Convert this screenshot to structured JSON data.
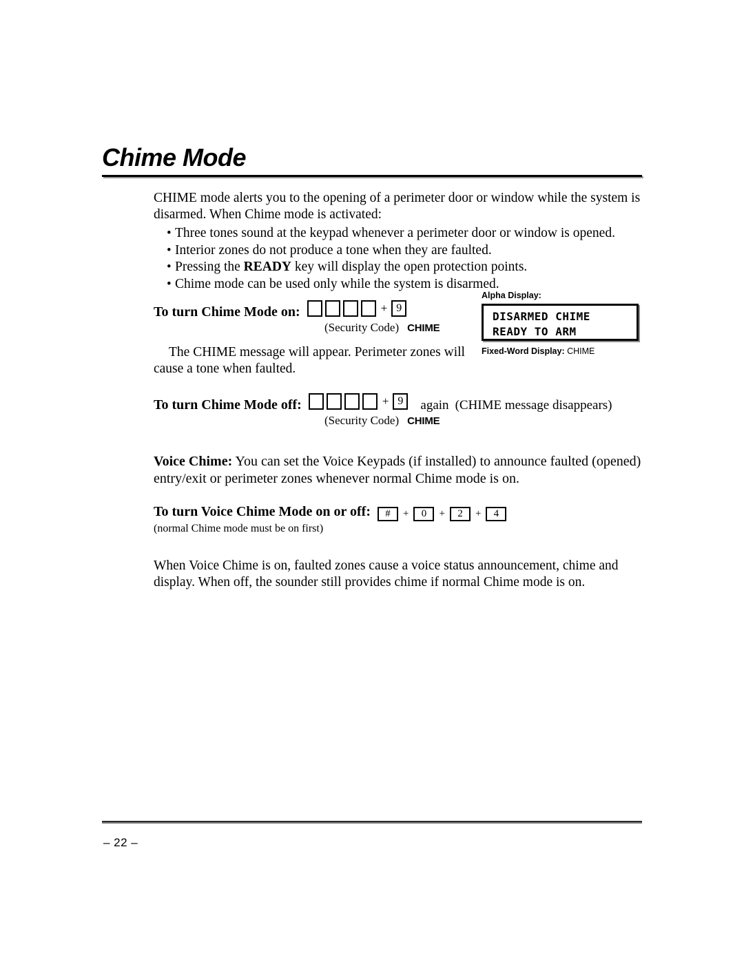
{
  "document": {
    "title": "Chime Mode",
    "page_number": "– 22 –"
  },
  "intro": {
    "paragraph": "CHIME mode alerts you to the opening of a perimeter door or window while the system is disarmed. When Chime mode is activated:",
    "bullet_char": "•",
    "bullets": [
      {
        "before": "Three tones sound at the keypad whenever a perimeter door or window is opened.",
        "bold": "",
        "after": ""
      },
      {
        "before": "Interior zones do not produce a tone when they are faulted.",
        "bold": "",
        "after": ""
      },
      {
        "before": "Pressing the ",
        "bold": "READY",
        "after": " key will display the open protection points."
      },
      {
        "before": "Chime mode can be used only while the system is disarmed.",
        "bold": "",
        "after": ""
      }
    ]
  },
  "chime_on": {
    "label": "To turn Chime Mode on:",
    "code_boxes": [
      "",
      "",
      "",
      ""
    ],
    "plus": "+",
    "function_key": "9",
    "security_code_caption": "(Security Code)",
    "function_caption": "CHIME",
    "description": "The CHIME message will appear. Perimeter zones will cause a tone when faulted."
  },
  "chime_off": {
    "label": "To turn Chime Mode off:",
    "code_boxes": [
      "",
      "",
      "",
      ""
    ],
    "plus": "+",
    "function_key": "9",
    "again_text": "again",
    "result_text": "(CHIME message disappears)",
    "security_code_caption": "(Security Code)",
    "function_caption": "CHIME"
  },
  "voice_chime": {
    "heading": "Voice Chime:",
    "intro": " You can set the Voice Keypads (if installed) to announce faulted (opened) entry/exit or perimeter zones whenever normal Chime mode is on.",
    "toggle_label": "To turn Voice Chime Mode on or off:",
    "keys": [
      "#",
      "0",
      "2",
      "4"
    ],
    "separator": "+",
    "note": "(normal Chime mode must be on first)",
    "closing_paragraph": "When Voice Chime is on, faulted zones cause a voice status announcement, chime and display. When off, the sounder still provides chime if normal Chime mode is on."
  },
  "alpha_display": {
    "caption": "Alpha Display:",
    "line1": "DISARMED CHIME",
    "line2": "READY TO ARM",
    "fixed_word_label": "Fixed-Word Display:",
    "fixed_word_value": "CHIME"
  },
  "colors": {
    "text": "#000000",
    "background": "#ffffff",
    "rule_shadow": "#8c8c8c"
  }
}
